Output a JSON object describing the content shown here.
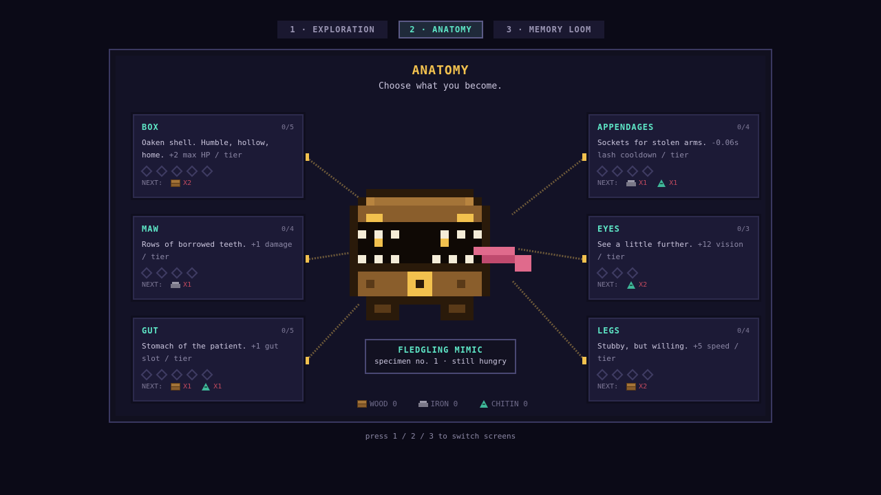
{
  "tabs": [
    {
      "label": "1 · EXPLORATION",
      "active": false
    },
    {
      "label": "2 · ANATOMY",
      "active": true
    },
    {
      "label": "3 · MEMORY LOOM",
      "active": false
    }
  ],
  "screen": {
    "title": "ANATOMY",
    "subtitle": "Choose what you become."
  },
  "cards": {
    "box": {
      "name": "BOX",
      "count": "0/5",
      "desc": "Oaken shell. Humble, hollow, home.",
      "bonus": "+2 max HP / tier",
      "tiers_total": 5,
      "tiers_filled": 0,
      "next_label": "NEXT:",
      "costs": [
        {
          "resource": "wood",
          "amount": "X2"
        }
      ]
    },
    "maw": {
      "name": "MAW",
      "count": "0/4",
      "desc": "Rows of borrowed teeth.",
      "bonus": "+1 damage / tier",
      "tiers_total": 4,
      "tiers_filled": 0,
      "next_label": "NEXT:",
      "costs": [
        {
          "resource": "iron",
          "amount": "X1"
        }
      ]
    },
    "gut": {
      "name": "GUT",
      "count": "0/5",
      "desc": "Stomach of the patient.",
      "bonus": "+1 gut slot / tier",
      "tiers_total": 5,
      "tiers_filled": 0,
      "next_label": "NEXT:",
      "costs": [
        {
          "resource": "wood",
          "amount": "X1"
        },
        {
          "resource": "chitin",
          "amount": "X1"
        }
      ]
    },
    "appendages": {
      "name": "APPENDAGES",
      "count": "0/4",
      "desc": "Sockets for stolen arms.",
      "bonus": "-0.06s lash cooldown / tier",
      "tiers_total": 4,
      "tiers_filled": 0,
      "next_label": "NEXT:",
      "costs": [
        {
          "resource": "iron",
          "amount": "X1"
        },
        {
          "resource": "chitin",
          "amount": "X1"
        }
      ]
    },
    "eyes": {
      "name": "EYES",
      "count": "0/3",
      "desc": "See a little further.",
      "bonus": "+12 vision / tier",
      "tiers_total": 3,
      "tiers_filled": 0,
      "next_label": "NEXT:",
      "costs": [
        {
          "resource": "chitin",
          "amount": "X2"
        }
      ]
    },
    "legs": {
      "name": "LEGS",
      "count": "0/4",
      "desc": "Stubby, but willing.",
      "bonus": "+5 speed / tier",
      "tiers_total": 4,
      "tiers_filled": 0,
      "next_label": "NEXT:",
      "costs": [
        {
          "resource": "wood",
          "amount": "X2"
        }
      ]
    }
  },
  "creature": {
    "name": "FLEDGLING MIMIC",
    "subtitle": "specimen no. 1 · still hungry"
  },
  "resources": [
    {
      "icon": "wood-icon",
      "label": "WOOD 0"
    },
    {
      "icon": "iron-icon",
      "label": "IRON 0"
    },
    {
      "icon": "chitin-icon",
      "label": "CHITIN 0"
    }
  ],
  "hint": "press 1 / 2 / 3 to switch screens",
  "colors": {
    "accent": "#5ee6c6",
    "title": "#f2c14e",
    "cost": "#c24a5e",
    "background": "#0b0a17"
  }
}
